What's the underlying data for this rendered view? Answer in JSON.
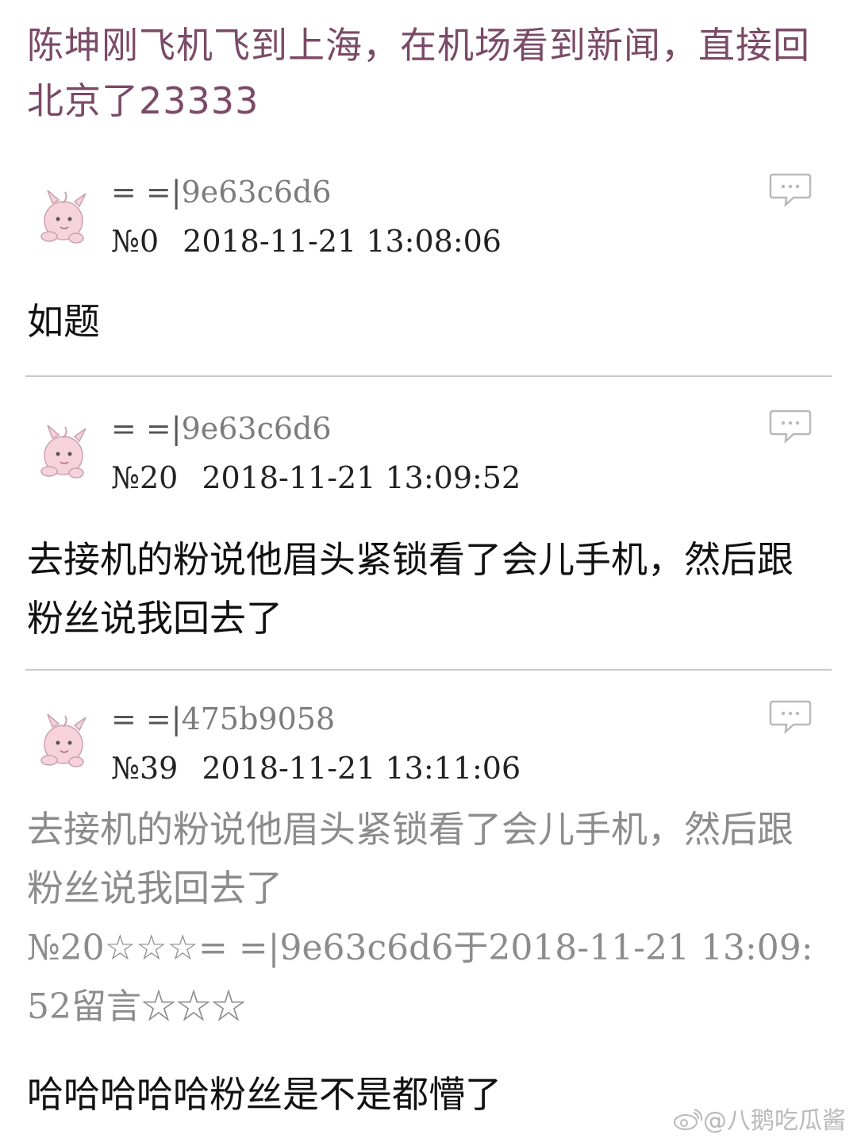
{
  "thread": {
    "title": "陈坤刚飞机飞到上海，在机场看到新闻，直接回北京了23333"
  },
  "posts": [
    {
      "author_prefix": "= =|",
      "author_id": "9e63c6d6",
      "number": "№0",
      "timestamp": "2018-11-21 13:08:06",
      "content": "如题"
    },
    {
      "author_prefix": "= =|",
      "author_id": "9e63c6d6",
      "number": "№20",
      "timestamp": "2018-11-21 13:09:52",
      "content": "去接机的粉说他眉头紧锁看了会儿手机，然后跟粉丝说我回去了"
    },
    {
      "author_prefix": "= =|",
      "author_id": "475b9058",
      "number": "№39",
      "timestamp": "2018-11-21 13:11:06",
      "quote_text": "去接机的粉说他眉头紧锁看了会儿手机，然后跟粉丝说我回去了",
      "quote_ref": "№20☆☆☆= =|9e63c6d6于2018-11-21 13:09:52留言☆☆☆",
      "content": "哈哈哈哈哈粉丝是不是都懵了"
    }
  ],
  "icons": {
    "avatar": "pink-creature-avatar-icon",
    "reply": "speech-bubble-icon",
    "watermark": "weibo-eye-icon"
  },
  "watermark": {
    "text": "@八鹅吃瓜酱"
  },
  "colors": {
    "title": "#7b4a67",
    "author": "#7c7c7c",
    "quote": "#8c8c8c",
    "divider": "#c9c9c9",
    "avatar_pink": "#f6d2dc"
  }
}
